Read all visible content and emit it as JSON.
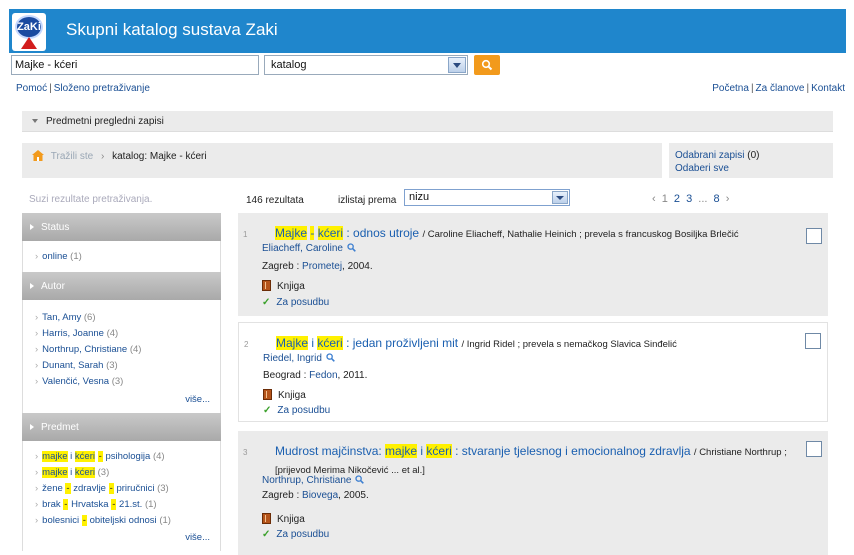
{
  "header": {
    "logo_text": "ZaKi",
    "title": "Skupni katalog sustava Zaki"
  },
  "search": {
    "query": "Majke - kćeri",
    "scope": "katalog"
  },
  "top_links_left": [
    "Pomoć",
    "Složeno pretraživanje"
  ],
  "top_links_right": [
    "Početna",
    "Za članove",
    "Kontakt"
  ],
  "subject_bar": {
    "label": "Predmetni pregledni zapisi"
  },
  "breadcrumb": {
    "searched": "Tražili ste",
    "current": "katalog: Majke - kćeri"
  },
  "saved": {
    "selected_label": "Odabrani zapisi",
    "selected_count": "(0)",
    "select_all": "Odaberi sve"
  },
  "refine": {
    "placeholder": "Suzi rezultate pretraživanja."
  },
  "facets": {
    "status": {
      "title": "Status",
      "items": [
        {
          "label": "online",
          "count": "(1)"
        }
      ]
    },
    "autor": {
      "title": "Autor",
      "items": [
        {
          "label": "Tan, Amy",
          "count": "(6)"
        },
        {
          "label": "Harris, Joanne",
          "count": "(4)"
        },
        {
          "label": "Northrup, Christiane",
          "count": "(4)"
        },
        {
          "label": "Dunant, Sarah",
          "count": "(3)"
        },
        {
          "label": "Valenčić, Vesna",
          "count": "(3)"
        }
      ],
      "more": "više..."
    },
    "predmet": {
      "title": "Predmet",
      "items": [
        {
          "a": "majke",
          "s1": "i",
          "b": "kćeri",
          "c": "psihologija",
          "count": "(4)"
        },
        {
          "a": "majke",
          "s1": "i",
          "b": "kćeri",
          "c": "",
          "count": "(3)"
        },
        {
          "a": "žene",
          "s1": "-",
          "b": "zdravlje",
          "c": "priručnici",
          "count": "(3)"
        },
        {
          "a": "brak",
          "s1": "-",
          "b": "Hrvatska",
          "c": "21.st.",
          "count": "(1)"
        },
        {
          "a": "bolesnici",
          "s1": "-",
          "b": "obiteljski odnosi",
          "c": "",
          "count": "(1)"
        }
      ],
      "more": "više..."
    }
  },
  "results_meta": {
    "count": "146 rezultata",
    "sort_label": "izlistaj prema",
    "sort_value": "nizu",
    "pages": [
      "1",
      "2",
      "3",
      "...",
      "8"
    ]
  },
  "results": [
    {
      "num": "1",
      "w1": "Majke",
      "w2": "-",
      "w3": "kćeri",
      "rest": ": odnos utroje",
      "resp": "/ Caroline Eliacheff, Nathalie Heinich ; prevela s francuskog Bosiljka Brlečić",
      "author": "Eliacheff, Caroline",
      "place": "Zagreb :",
      "publisher": "Prometej",
      "year": ", 2004.",
      "type": "Knjiga",
      "availability": "Za posudbu"
    },
    {
      "num": "2",
      "w1": "Majke",
      "w2": "i",
      "w3": "kćeri",
      "rest": ": jedan proživljeni mit",
      "resp": "/ Ingrid Ridel ; prevela s nemačkog Slavica Sinđelić",
      "author": "Riedel, Ingrid",
      "place": "Beograd :",
      "publisher": "Fedon",
      "year": ", 2011.",
      "type": "Knjiga",
      "availability": "Za posudbu"
    },
    {
      "num": "3",
      "prefix": "Mudrost majčinstva:",
      "w1": "majke",
      "w2": "i",
      "w3": "kćeri",
      "rest": ": stvaranje tjelesnog i emocionalnog zdravlja",
      "resp": "/ Christiane Northrup ; [prijevod Merima Nikočević ... et al.]",
      "author": "Northrup, Christiane",
      "place": "Zagreb :",
      "publisher": "Biovega",
      "year": ", 2005.",
      "type": "Knjiga",
      "availability": "Za posudbu"
    }
  ],
  "colors": {
    "header": "#1f86cc",
    "search_button": "#f29a1c",
    "highlight": "#fff100",
    "link": "#1a4f94"
  }
}
